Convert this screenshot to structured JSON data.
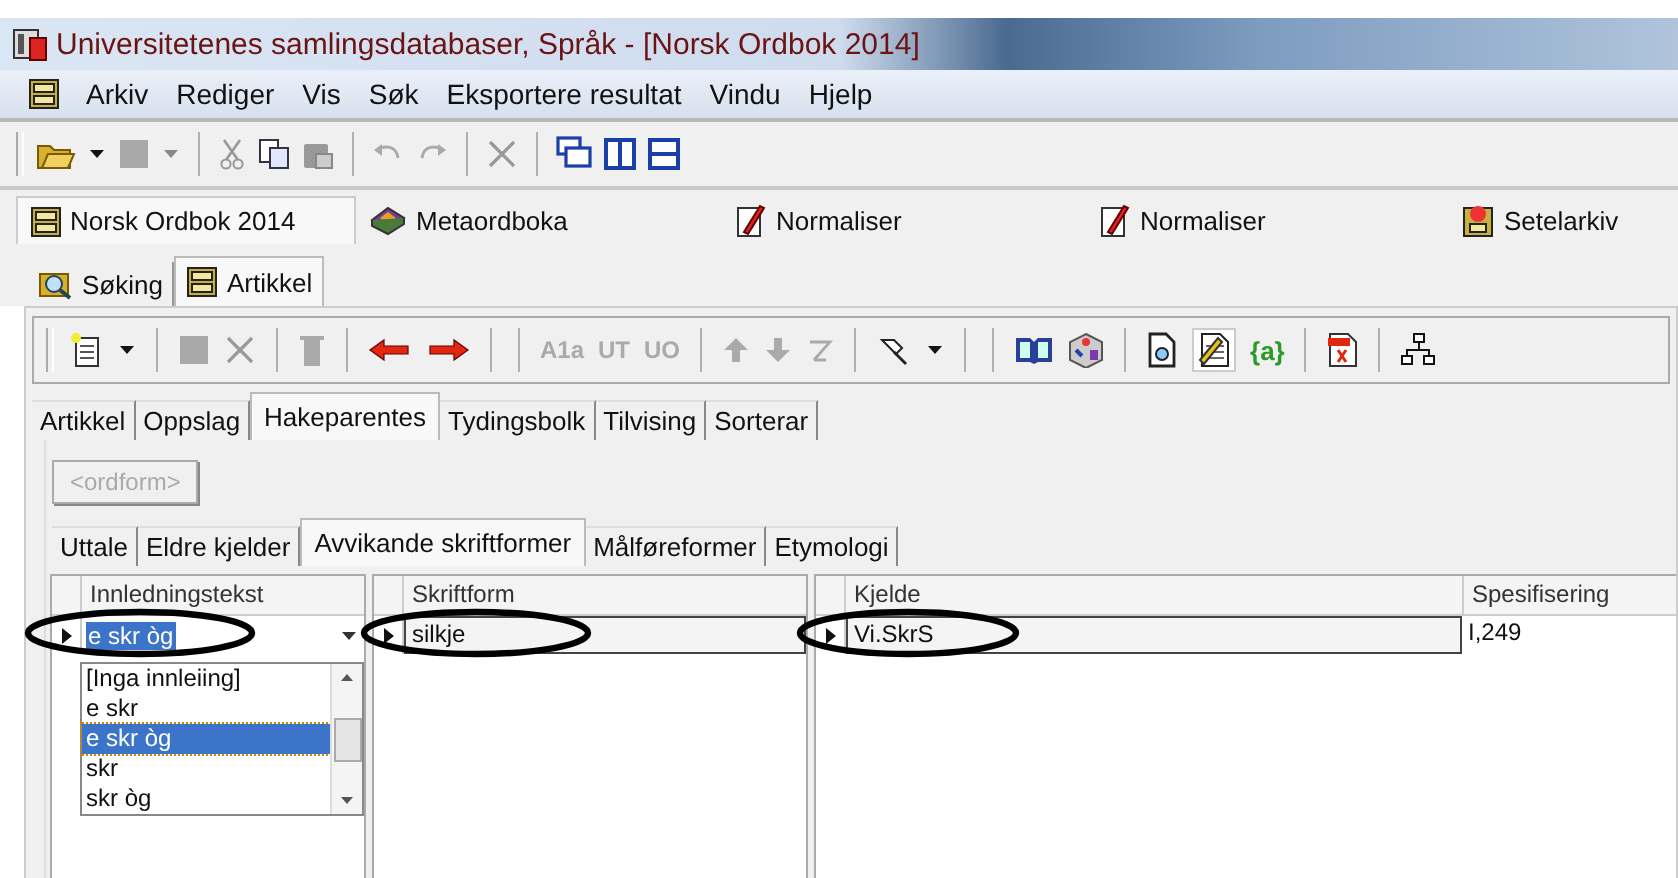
{
  "window": {
    "title": "Universitetenes samlingsdatabaser, Språk - [Norsk Ordbok 2014]"
  },
  "menu": [
    "Arkiv",
    "Rediger",
    "Vis",
    "Søk",
    "Eksportere resultat",
    "Vindu",
    "Hjelp"
  ],
  "document_tabs": [
    {
      "label": "Norsk Ordbok 2014",
      "selected": true
    },
    {
      "label": "Metaordboka",
      "selected": false
    },
    {
      "label": "Normaliser",
      "selected": false
    },
    {
      "label": "Normaliser",
      "selected": false
    },
    {
      "label": "Setelarkiv",
      "selected": false
    }
  ],
  "view_tabs": [
    {
      "label": "Søking",
      "selected": false
    },
    {
      "label": "Artikkel",
      "selected": true
    }
  ],
  "article_toolbar": {
    "format_buttons": [
      {
        "label": "A1a",
        "disabled": true
      },
      {
        "label": "UT",
        "disabled": true
      },
      {
        "label": "UO",
        "disabled": true
      }
    ],
    "variable_button": {
      "label": "{a}",
      "disabled": false
    }
  },
  "tabs": [
    {
      "label": "Artikkel",
      "selected": false
    },
    {
      "label": "Oppslag",
      "selected": false
    },
    {
      "label": "Hakeparentes",
      "selected": true
    },
    {
      "label": "Tydingsbolk",
      "selected": false
    },
    {
      "label": "Tilvising",
      "selected": false
    },
    {
      "label": "Sorterar",
      "selected": false
    }
  ],
  "ordform_button": {
    "label": "<ordform>",
    "disabled": true
  },
  "subtabs": [
    {
      "label": "Uttale",
      "selected": false
    },
    {
      "label": "Eldre kjelder",
      "selected": false
    },
    {
      "label": "Avvikande skriftformer",
      "selected": true
    },
    {
      "label": "Målføreformer",
      "selected": false
    },
    {
      "label": "Etymologi",
      "selected": false
    }
  ],
  "intro_panel": {
    "header": "Innledningstekst",
    "value": "e skr òg",
    "dropdown": {
      "options": [
        {
          "label": "[Inga innleiing]",
          "selected": false
        },
        {
          "label": "e skr",
          "selected": false
        },
        {
          "label": "e skr òg",
          "selected": true
        },
        {
          "label": "skr",
          "selected": false
        },
        {
          "label": "skr òg",
          "selected": false
        }
      ]
    }
  },
  "form_panel": {
    "header": "Skriftform",
    "value": "silkje"
  },
  "source_panel": {
    "columns": [
      "Kjelde",
      "Spesifisering"
    ],
    "rows": [
      [
        "Vi.SkrS",
        "I,249"
      ]
    ]
  }
}
